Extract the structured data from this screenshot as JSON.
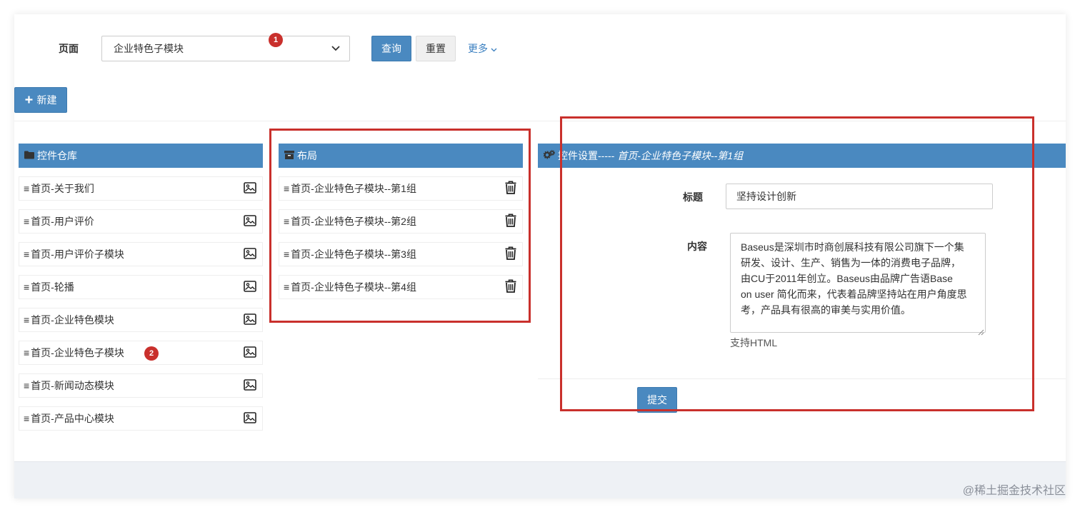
{
  "filter": {
    "page_label": "页面",
    "page_select_value": "企业特色子模块",
    "query_label": "查询",
    "reset_label": "重置",
    "more_label": "更多"
  },
  "toolbar": {
    "new_label": "新建"
  },
  "badges": {
    "one": "1",
    "two": "2"
  },
  "widget_library": {
    "title": "控件仓库",
    "items": [
      {
        "label": "首页-关于我们"
      },
      {
        "label": "首页-用户评价"
      },
      {
        "label": "首页-用户评价子模块"
      },
      {
        "label": "首页-轮播"
      },
      {
        "label": "首页-企业特色模块"
      },
      {
        "label": "首页-企业特色子模块"
      },
      {
        "label": "首页-新闻动态模块"
      },
      {
        "label": "首页-产品中心模块"
      }
    ]
  },
  "layout": {
    "title": "布局",
    "items": [
      {
        "label": "首页-企业特色子模块--第1组"
      },
      {
        "label": "首页-企业特色子模块--第2组"
      },
      {
        "label": "首页-企业特色子模块--第3组"
      },
      {
        "label": "首页-企业特色子模块--第4组"
      }
    ]
  },
  "settings": {
    "title_prefix": "控件设置-----",
    "title_suffix": "首页-企业特色子模块--第1组",
    "title_field_label": "标题",
    "title_field_value": "坚持设计创新",
    "content_field_label": "内容",
    "content_lines": [
      "Baseus是深圳市时商创展科技有限公司旗下一个集",
      "研发、设计、生产、销售为一体的消费电子品牌，",
      "由CU于2011年创立。Baseus由品牌广告语Base",
      "on user 简化而来，代表着品牌坚持站在用户角度思",
      "考，产品具有很高的审美与实用价值。"
    ],
    "content_help": "支持HTML",
    "submit_label": "提交"
  },
  "colors": {
    "primary": "#4a89c0",
    "annotation_red": "#c9302c"
  },
  "watermark": "@稀土掘金技术社区"
}
